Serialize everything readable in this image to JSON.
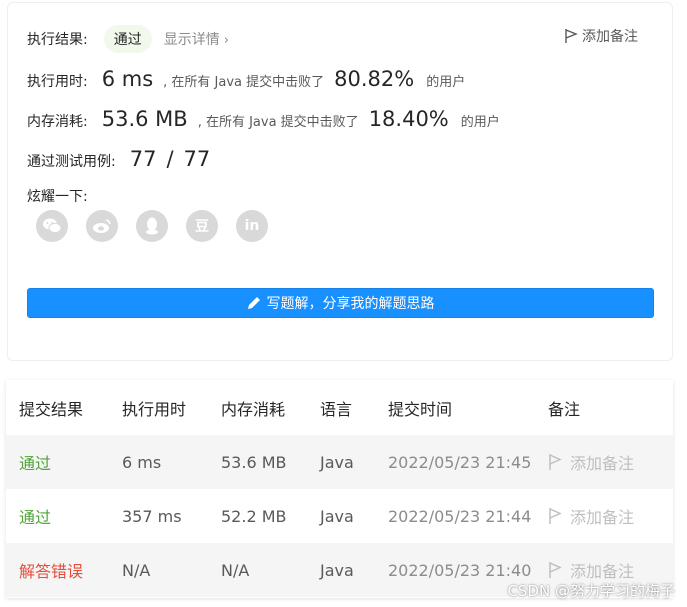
{
  "result": {
    "label": "执行结果:",
    "status": "通过",
    "details_link": "显示详情",
    "add_note": "添加备注"
  },
  "runtime": {
    "label": "执行用时:",
    "value": "6 ms",
    "mid": ", 在所有 Java 提交中击败了",
    "percent": "80.82%",
    "suffix": "的用户"
  },
  "memory": {
    "label": "内存消耗:",
    "value": "53.6 MB",
    "mid": ", 在所有 Java 提交中击败了",
    "percent": "18.40%",
    "suffix": "的用户"
  },
  "tests": {
    "label": "通过测试用例:",
    "passed": "77",
    "sep": "/",
    "total": "77"
  },
  "share": {
    "label": "炫耀一下:",
    "icons": [
      "wechat-icon",
      "weibo-icon",
      "qq-icon",
      "douban-icon",
      "linkedin-icon"
    ],
    "glyphs": [
      "",
      "",
      "",
      "豆",
      "in"
    ]
  },
  "write_solution_button": "写题解，分享我的解题思路",
  "table": {
    "headers": [
      "提交结果",
      "执行用时",
      "内存消耗",
      "语言",
      "提交时间",
      "备注"
    ],
    "rows": [
      {
        "result": "通过",
        "runtime": "6 ms",
        "memory": "53.6 MB",
        "lang": "Java",
        "time": "2022/05/23 21:45",
        "note": "添加备注"
      },
      {
        "result": "通过",
        "runtime": "357 ms",
        "memory": "52.2 MB",
        "lang": "Java",
        "time": "2022/05/23 21:44",
        "note": "添加备注"
      },
      {
        "result": "解答错误",
        "runtime": "N/A",
        "memory": "N/A",
        "lang": "Java",
        "time": "2022/05/23 21:40",
        "note": "添加备注"
      }
    ]
  },
  "colors": {
    "accent": "#1890ff",
    "success": "#52a43a",
    "error": "#e74c3c"
  },
  "watermark": "CSDN @努力学习的梅子"
}
